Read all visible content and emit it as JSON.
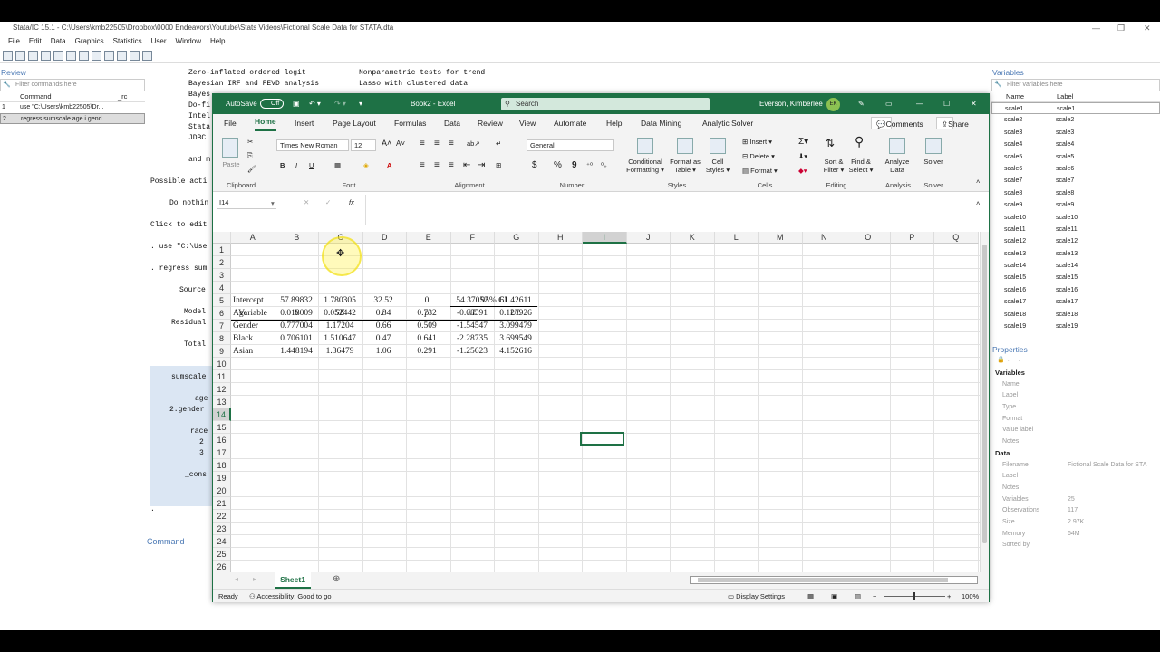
{
  "stata": {
    "title": "Stata/IC 15.1 - C:\\Users\\kmb22505\\Dropbox\\0000 Endeavors\\Youtube\\Stats Videos\\Fictional Scale Data for STATA.dta",
    "menu": [
      "File",
      "Edit",
      "Data",
      "Graphics",
      "Statistics",
      "User",
      "Window",
      "Help"
    ],
    "review": {
      "title": "Review",
      "filter_placeholder": "Filter commands here",
      "col_command": "Command",
      "col_rc": "_rc",
      "items": [
        {
          "n": "1",
          "cmd": "use \"C:\\Users\\kmb22505\\Dr..."
        },
        {
          "n": "2",
          "cmd": "regress sumscale age i.gend..."
        }
      ]
    },
    "results": {
      "l1a": "Zero-inflated ordered logit",
      "l1b": "Nonparametric tests for trend",
      "l2a": "Bayesian IRF and FEVD analysis",
      "l2b": "Lasso with clustered data",
      "l3": "Bayes",
      "l4": "Do-fi",
      "l5": "Intel",
      "l6": "Stata",
      "l7": "JDBC",
      "l8": "and m",
      "l9": "Possible acti",
      "l10": "Do nothin",
      "l11": "Click to edit",
      "l12": ". use \"C:\\Use",
      "l13": ". regress sum",
      "src": "Source",
      "model": "Model",
      "resid": "Residual",
      "total": "Total",
      "dep": "sumscale",
      "age": "age",
      "gender": "2.gender",
      "race": "race",
      "r2": "2",
      "r3": "3",
      "cons": "_cons",
      "dot": "."
    },
    "command_label": "Command",
    "variables": {
      "title": "Variables",
      "filter_placeholder": "Filter variables here",
      "col_name": "Name",
      "col_label": "Label",
      "rows": [
        "scale1",
        "scale2",
        "scale3",
        "scale4",
        "scale5",
        "scale6",
        "scale7",
        "scale8",
        "scale9",
        "scale10",
        "scale11",
        "scale12",
        "scale13",
        "scale14",
        "scale15",
        "scale16",
        "scale17",
        "scale18",
        "scale19"
      ]
    },
    "properties": {
      "title": "Properties",
      "sec_variables": "Variables",
      "var_props": [
        "Name",
        "Label",
        "Type",
        "Format",
        "Value label",
        "Notes"
      ],
      "sec_data": "Data",
      "data_props": [
        {
          "k": "Filename",
          "v": "Fictional Scale Data for STA"
        },
        {
          "k": "Label",
          "v": ""
        },
        {
          "k": "Notes",
          "v": ""
        },
        {
          "k": "Variables",
          "v": "25"
        },
        {
          "k": "Observations",
          "v": "117"
        },
        {
          "k": "Size",
          "v": "2.97K"
        },
        {
          "k": "Memory",
          "v": "64M"
        },
        {
          "k": "Sorted by",
          "v": ""
        }
      ]
    }
  },
  "excel": {
    "autosave": "AutoSave",
    "autosave_state": "Off",
    "doc": "Book2 - Excel",
    "search": "Search",
    "user": "Everson, Kimberlee",
    "initials": "EK",
    "tabs": [
      "File",
      "Home",
      "Insert",
      "Page Layout",
      "Formulas",
      "Data",
      "Review",
      "View",
      "Automate",
      "Help",
      "Data Mining",
      "Analytic Solver"
    ],
    "comments": "Comments",
    "share": "Share",
    "font": "Times New Roman",
    "size": "12",
    "number_format": "General",
    "ribbon": {
      "paste": "Paste",
      "clipboard": "Clipboard",
      "font": "Font",
      "alignment": "Alignment",
      "number": "Number",
      "cond": "Conditional",
      "formatting": "Formatting",
      "format_as": "Format as",
      "table": "Table",
      "cell": "Cell",
      "styles_b": "Styles",
      "styles": "Styles",
      "insert": "Insert",
      "delete": "Delete",
      "format": "Format",
      "cells": "Cells",
      "sort": "Sort &",
      "filter": "Filter",
      "find": "Find &",
      "select": "Select",
      "editing": "Editing",
      "analyze": "Analyze",
      "data_b": "Data",
      "analysis": "Analysis",
      "solver": "Solver",
      "solver_g": "Solver",
      "bold": "B",
      "italic": "I",
      "underline": "U",
      "currency": "$",
      "percent": "%",
      "comma": "9"
    },
    "namebox": "I14",
    "fx": "fx",
    "columns": [
      "A",
      "B",
      "C",
      "D",
      "E",
      "F",
      "G",
      "H",
      "I",
      "J",
      "K",
      "L",
      "M",
      "N",
      "O",
      "P",
      "Q"
    ],
    "rows": [
      "1",
      "2",
      "3",
      "4",
      "5",
      "6",
      "7",
      "8",
      "9",
      "10",
      "11",
      "12",
      "13",
      "14",
      "15",
      "16",
      "17",
      "18",
      "19",
      "20",
      "21",
      "22",
      "23",
      "24",
      "25",
      "26"
    ],
    "table": {
      "ci": "95% CI",
      "headers": [
        "Variable",
        "b",
        "SE",
        "t",
        "p",
        "LL",
        "UL"
      ],
      "data": [
        [
          "Intercept",
          "57.89832",
          "1.780305",
          "32.52",
          "0",
          "54.37052",
          "61.42611"
        ],
        [
          "Age",
          "0.018009",
          "0.052442",
          "0.34",
          "0.732",
          "-0.08591",
          "0.121926"
        ],
        [
          "Gender",
          "0.777004",
          "1.17204",
          "0.66",
          "0.509",
          "-1.54547",
          "3.099479"
        ],
        [
          "Black",
          "0.706101",
          "1.510647",
          "0.47",
          "0.641",
          "-2.28735",
          "3.699549"
        ],
        [
          "Asian",
          "1.448194",
          "1.36479",
          "1.06",
          "0.291",
          "-1.25623",
          "4.152616"
        ]
      ]
    },
    "sheet": "Sheet1",
    "status_ready": "Ready",
    "status_access": "Accessibility: Good to go",
    "display_settings": "Display Settings",
    "zoom": "100%"
  }
}
